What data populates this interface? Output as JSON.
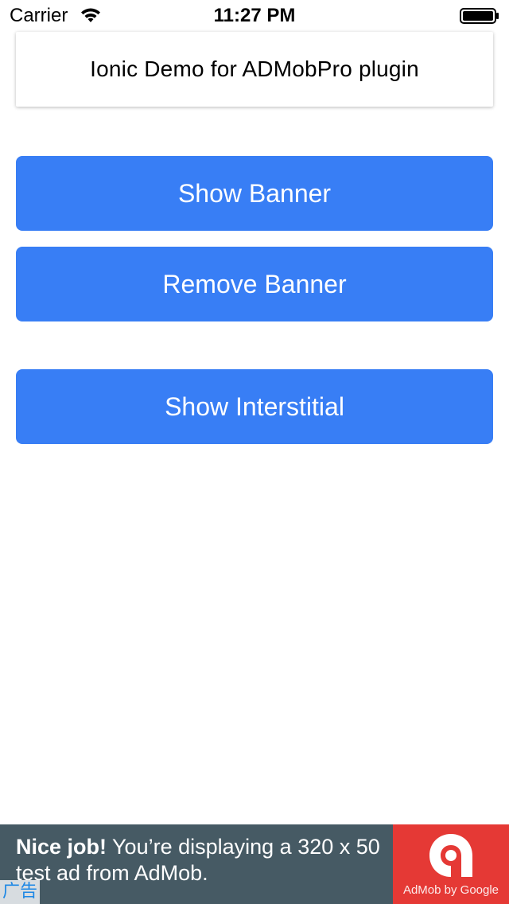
{
  "status_bar": {
    "carrier": "Carrier",
    "time": "11:27 PM",
    "wifi_icon": "wifi-icon",
    "battery_icon": "battery-icon"
  },
  "header": {
    "title": "Ionic Demo for ADMobPro plugin"
  },
  "buttons": {
    "show_banner": "Show Banner",
    "remove_banner": "Remove Banner",
    "show_interstitial": "Show Interstitial"
  },
  "ad": {
    "headline_bold": "Nice job!",
    "headline_rest": " You’re displaying a 320 x 50 test ad from AdMob.",
    "brand": "AdMob by Google",
    "tag": "广告",
    "logo_icon": "admob-logo-icon"
  },
  "colors": {
    "button_bg": "#387ef5",
    "ad_bg": "#465a64",
    "ad_logo_bg": "#e53935",
    "ad_tag_text": "#1e88e5"
  }
}
